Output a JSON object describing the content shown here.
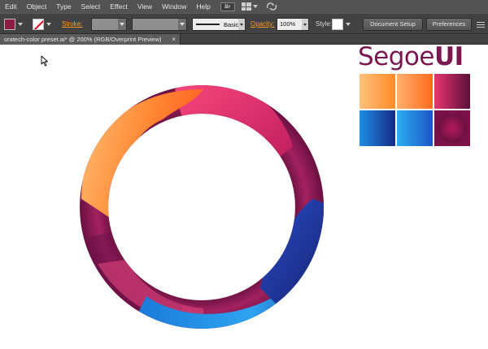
{
  "menu": {
    "items": [
      "Edit",
      "Object",
      "Type",
      "Select",
      "Effect",
      "View",
      "Window",
      "Help"
    ],
    "bridge_badge": "Br"
  },
  "control_bar": {
    "fill_color": "#8c1c45",
    "stroke_color": "none",
    "stroke_label": "Stroke:",
    "brush_label": "Basic",
    "opacity_label": "Opacity:",
    "opacity_value": "100%",
    "style_label": "Style:",
    "document_setup_button": "Document Setup",
    "preferences_button": "Preferences"
  },
  "document_tab": {
    "title": "oratech-color preset.ai* @ 200% (RGB/Overprint Preview)",
    "close_glyph": "×"
  },
  "artwork": {
    "logo": {
      "light": "Segoe",
      "bold": "UI",
      "color": "#7a1750"
    },
    "swatches": [
      {
        "name": "orange-light",
        "from": "#fec17a",
        "to": "#ff8a2a"
      },
      {
        "name": "orange",
        "from": "#ffb070",
        "to": "#ff6a1c"
      },
      {
        "name": "magenta-dark",
        "from": "#e8356f",
        "to": "#5a0f3a"
      },
      {
        "name": "blue-dark",
        "from": "#1e8ee8",
        "to": "#152a85"
      },
      {
        "name": "blue-light",
        "from": "#2bb0f0",
        "to": "#1d55c8"
      },
      {
        "name": "magenta-radial",
        "from": "#b41a5a",
        "to": "#6a1040"
      }
    ],
    "ring_colors": {
      "base": "#8e1a52",
      "dark": "#4a0b30",
      "pink": "#e83a75",
      "orange": "#ff6a1c",
      "peach": "#fec17a",
      "blue": "#1e8ee8",
      "navy": "#1a2a8a"
    }
  }
}
